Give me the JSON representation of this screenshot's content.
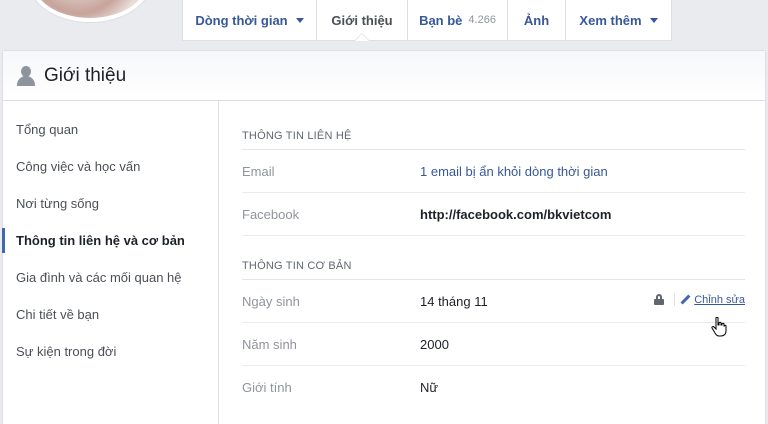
{
  "nav": {
    "tabs": [
      {
        "label": "Dòng thời gian",
        "has_caret": true
      },
      {
        "label": "Giới thiệu",
        "active": true
      },
      {
        "label": "Bạn bè",
        "count": "4.266"
      },
      {
        "label": "Ảnh"
      },
      {
        "label": "Xem thêm",
        "has_caret": true
      }
    ]
  },
  "section": {
    "title": "Giới thiệu",
    "icon": "person-icon"
  },
  "sidebar": {
    "items": [
      {
        "label": "Tổng quan"
      },
      {
        "label": "Công việc và học vấn"
      },
      {
        "label": "Nơi từng sống"
      },
      {
        "label": "Thông tin liên hệ và cơ bản",
        "active": true
      },
      {
        "label": "Gia đình và các mối quan hệ"
      },
      {
        "label": "Chi tiết về bạn"
      },
      {
        "label": "Sự kiện trong đời"
      }
    ]
  },
  "contact": {
    "title": "THÔNG TIN LIÊN HỆ",
    "rows": [
      {
        "label": "Email",
        "value": "1 email bị ẩn khỏi dòng thời gian"
      },
      {
        "label": "Facebook",
        "value": "http://facebook.com/bkvietcom"
      }
    ]
  },
  "basic": {
    "title": "THÔNG TIN CƠ BẢN",
    "rows": [
      {
        "label": "Ngày sinh",
        "value": "14 tháng 11"
      },
      {
        "label": "Năm sinh",
        "value": "2000"
      },
      {
        "label": "Giới tính",
        "value": "Nữ"
      }
    ],
    "edit_label": "Chỉnh sửa"
  },
  "colors": {
    "link": "#365899",
    "accent": "#4267b2",
    "muted": "#90949c"
  }
}
